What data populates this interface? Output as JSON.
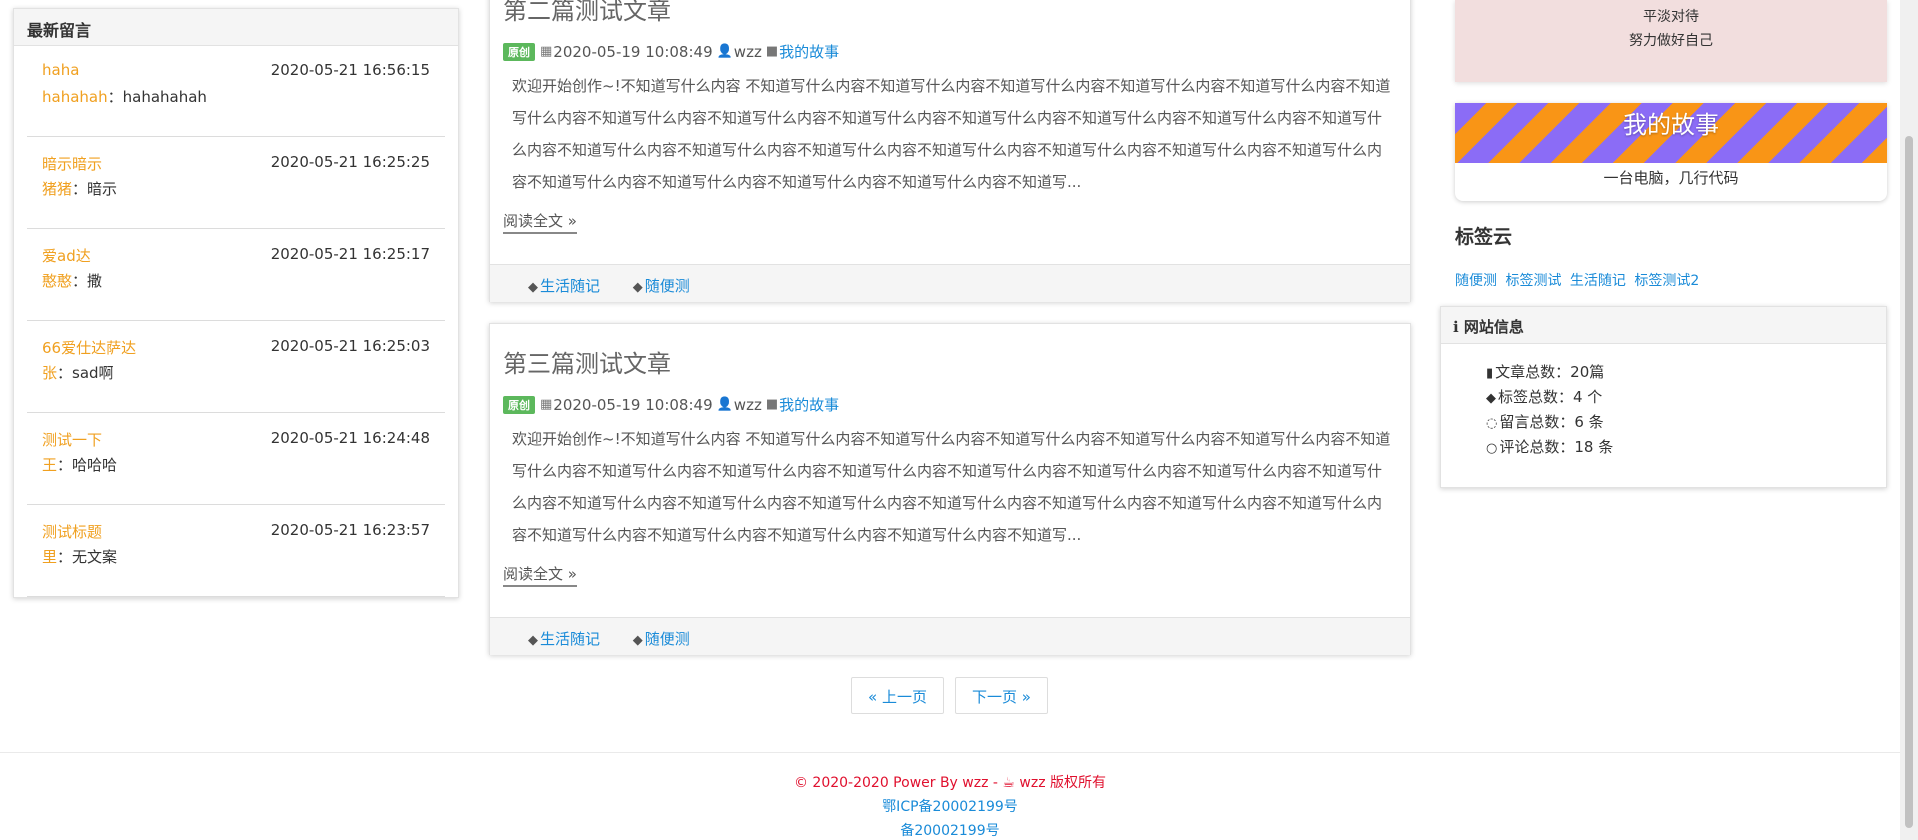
{
  "messages": {
    "header": "最新留言",
    "items": [
      {
        "title": "haha",
        "time": "2020-05-21 16:56:15",
        "author": "hahahah",
        "sep": "：",
        "content": "hahahahah"
      },
      {
        "title": "暗示暗示",
        "time": "2020-05-21 16:25:25",
        "author": "猪猪",
        "sep": "：",
        "content": "暗示"
      },
      {
        "title": "爱ad达",
        "time": "2020-05-21 16:25:17",
        "author": "憨憨",
        "sep": "：",
        "content": "撒"
      },
      {
        "title": "66爱仕达萨达",
        "time": "2020-05-21 16:25:03",
        "author": "张",
        "sep": "：",
        "content": "sad啊"
      },
      {
        "title": "测试一下",
        "time": "2020-05-21 16:24:48",
        "author": "王",
        "sep": "：",
        "content": "哈哈哈"
      },
      {
        "title": "测试标题",
        "time": "2020-05-21 16:23:57",
        "author": "里",
        "sep": "：",
        "content": "无文案"
      }
    ]
  },
  "articles": [
    {
      "title": "第二篇测试文章",
      "badge": "原创",
      "date": "2020-05-19 10:08:49",
      "author": "wzz",
      "category": "我的故事",
      "excerpt": "欢迎开始创作~!不知道写什么内容 不知道写什么内容不知道写什么内容不知道写什么内容不知道写什么内容不知道写什么内容不知道写什么内容不知道写什么内容不知道写什么内容不知道写什么内容不知道写什么内容不知道写什么内容不知道写什么内容不知道写什么内容不知道写什么内容不知道写什么内容不知道写什么内容不知道写什么内容不知道写什么内容不知道写什么内容不知道写什么内容不知道写什么内容不知道写什么内容不知道写什么内容不知道写什么内容不知道写...",
      "readmore": "阅读全文 »",
      "tags": [
        "生活随记",
        "随便测"
      ]
    },
    {
      "title": "第三篇测试文章",
      "badge": "原创",
      "date": "2020-05-19 10:08:49",
      "author": "wzz",
      "category": "我的故事",
      "excerpt": "欢迎开始创作~!不知道写什么内容 不知道写什么内容不知道写什么内容不知道写什么内容不知道写什么内容不知道写什么内容不知道写什么内容不知道写什么内容不知道写什么内容不知道写什么内容不知道写什么内容不知道写什么内容不知道写什么内容不知道写什么内容不知道写什么内容不知道写什么内容不知道写什么内容不知道写什么内容不知道写什么内容不知道写什么内容不知道写什么内容不知道写什么内容不知道写什么内容不知道写什么内容不知道写什么内容不知道写...",
      "readmore": "阅读全文 »",
      "tags": [
        "生活随记",
        "随便测"
      ]
    }
  ],
  "pager": {
    "prev": "« 上一页",
    "next": "下一页 »"
  },
  "sidebar": {
    "motto": [
      "平淡对待",
      "努力做好自己"
    ],
    "story": {
      "title": "我的故事",
      "subtitle": "一台电脑，几行代码"
    },
    "tagcloud": {
      "title": "标签云",
      "tags": [
        "随便测",
        "标签测试",
        "生活随记",
        "标签测试2"
      ]
    },
    "site_info": {
      "header": "网站信息",
      "rows": [
        {
          "icon": "file-icon",
          "text": "文章总数：20篇"
        },
        {
          "icon": "tags-icon",
          "text": "标签总数：4 个"
        },
        {
          "icon": "comments-icon",
          "text": "留言总数：6 条"
        },
        {
          "icon": "comment-icon",
          "text": "评论总数：18 条"
        }
      ]
    }
  },
  "footer": {
    "copyright": "© 2020-2020 Power By wzz -",
    "owner": "wzz 版权所有",
    "icp1": "鄂ICP备20002199号",
    "icp2": "备20002199号"
  },
  "colors": {
    "accent": "#1a8bd8",
    "author": "#f0a020",
    "badge": "#5cb85c",
    "footer": "#e0102e",
    "motto_bg": "#f2dede"
  }
}
